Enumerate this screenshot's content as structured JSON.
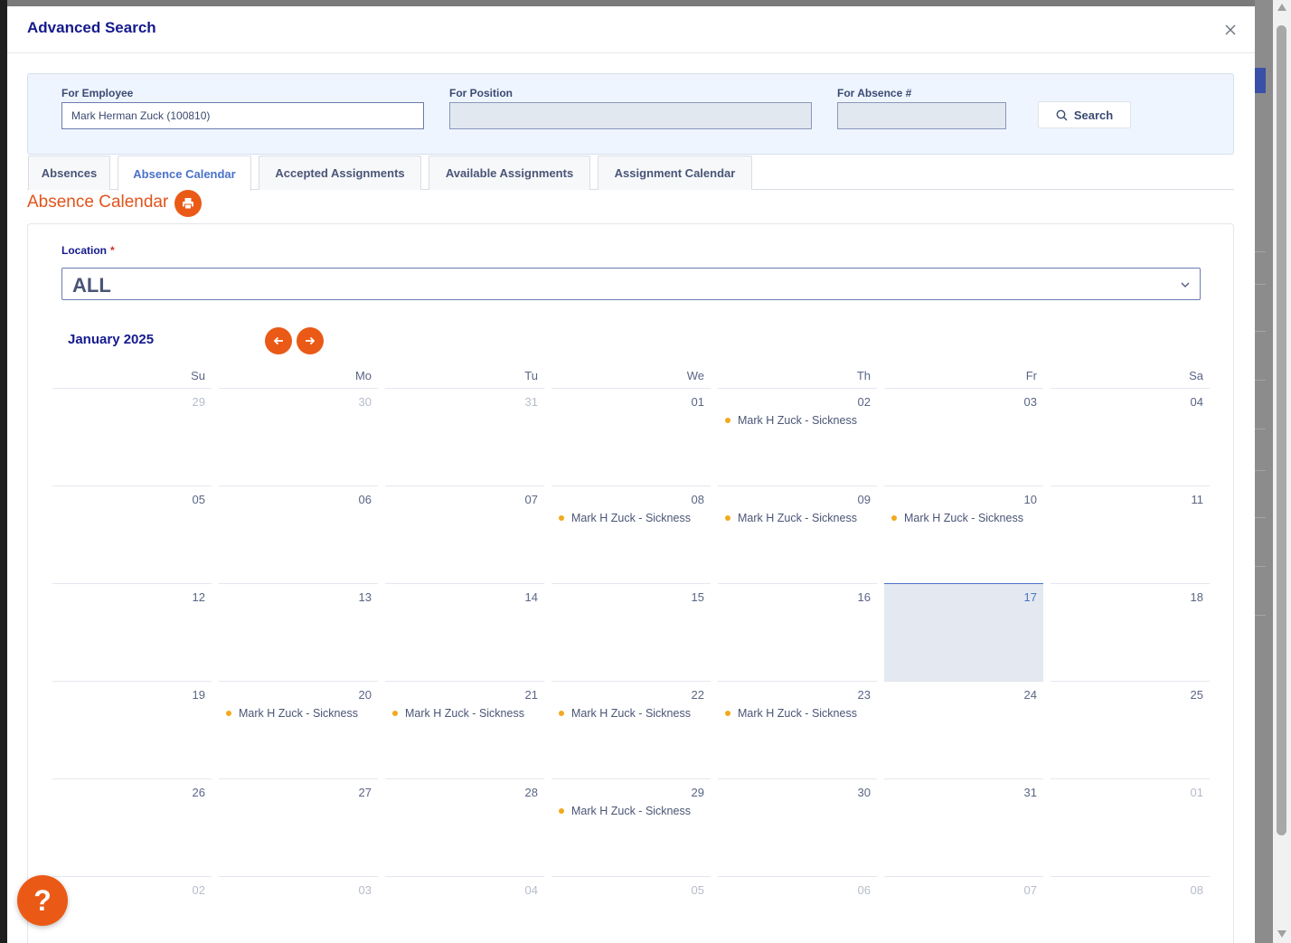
{
  "modal": {
    "title": "Advanced Search",
    "close_icon": "close-icon"
  },
  "search": {
    "employee_label": "For Employee",
    "employee_value": "Mark Herman Zuck (100810)",
    "position_label": "For Position",
    "position_value": "",
    "absence_label": "For Absence #",
    "absence_value": "",
    "search_button": "Search",
    "search_icon": "search-icon"
  },
  "tabs": [
    {
      "label": "Absences",
      "active": false
    },
    {
      "label": "Absence Calendar",
      "active": true
    },
    {
      "label": "Accepted Assignments",
      "active": false
    },
    {
      "label": "Available Assignments",
      "active": false
    },
    {
      "label": "Assignment Calendar",
      "active": false
    }
  ],
  "section": {
    "title": "Absence Calendar",
    "print_icon": "print-icon"
  },
  "location": {
    "label": "Location",
    "required_mark": "*",
    "value": "ALL"
  },
  "calendar": {
    "month_title": "January 2025",
    "weekdays": [
      "Su",
      "Mo",
      "Tu",
      "We",
      "Th",
      "Fr",
      "Sa"
    ],
    "weeks": [
      [
        {
          "day": "29",
          "other": true
        },
        {
          "day": "30",
          "other": true
        },
        {
          "day": "31",
          "other": true
        },
        {
          "day": "01"
        },
        {
          "day": "02",
          "event": "Mark H Zuck - Sickness"
        },
        {
          "day": "03"
        },
        {
          "day": "04"
        }
      ],
      [
        {
          "day": "05"
        },
        {
          "day": "06"
        },
        {
          "day": "07"
        },
        {
          "day": "08",
          "event": "Mark H Zuck - Sickness"
        },
        {
          "day": "09",
          "event": "Mark H Zuck - Sickness"
        },
        {
          "day": "10",
          "event": "Mark H Zuck - Sickness"
        },
        {
          "day": "11"
        }
      ],
      [
        {
          "day": "12"
        },
        {
          "day": "13"
        },
        {
          "day": "14"
        },
        {
          "day": "15"
        },
        {
          "day": "16"
        },
        {
          "day": "17",
          "today": true
        },
        {
          "day": "18"
        }
      ],
      [
        {
          "day": "19"
        },
        {
          "day": "20",
          "event": "Mark H Zuck - Sickness"
        },
        {
          "day": "21",
          "event": "Mark H Zuck - Sickness"
        },
        {
          "day": "22",
          "event": "Mark H Zuck - Sickness"
        },
        {
          "day": "23",
          "event": "Mark H Zuck - Sickness"
        },
        {
          "day": "24"
        },
        {
          "day": "25"
        }
      ],
      [
        {
          "day": "26"
        },
        {
          "day": "27"
        },
        {
          "day": "28"
        },
        {
          "day": "29",
          "event": "Mark H Zuck - Sickness"
        },
        {
          "day": "30"
        },
        {
          "day": "31"
        },
        {
          "day": "01",
          "other": true
        }
      ],
      [
        {
          "day": "02",
          "other": true
        },
        {
          "day": "03",
          "other": true
        },
        {
          "day": "04",
          "other": true
        },
        {
          "day": "05",
          "other": true
        },
        {
          "day": "06",
          "other": true
        },
        {
          "day": "07",
          "other": true
        },
        {
          "day": "08",
          "other": true
        }
      ]
    ]
  },
  "help": {
    "label": "?"
  },
  "colors": {
    "accent_orange": "#ea5a16",
    "navy": "#141a8c",
    "active_tab_blue": "#4a72c8",
    "event_dot": "#f2a91c",
    "today_bg": "#e4e9f1"
  }
}
